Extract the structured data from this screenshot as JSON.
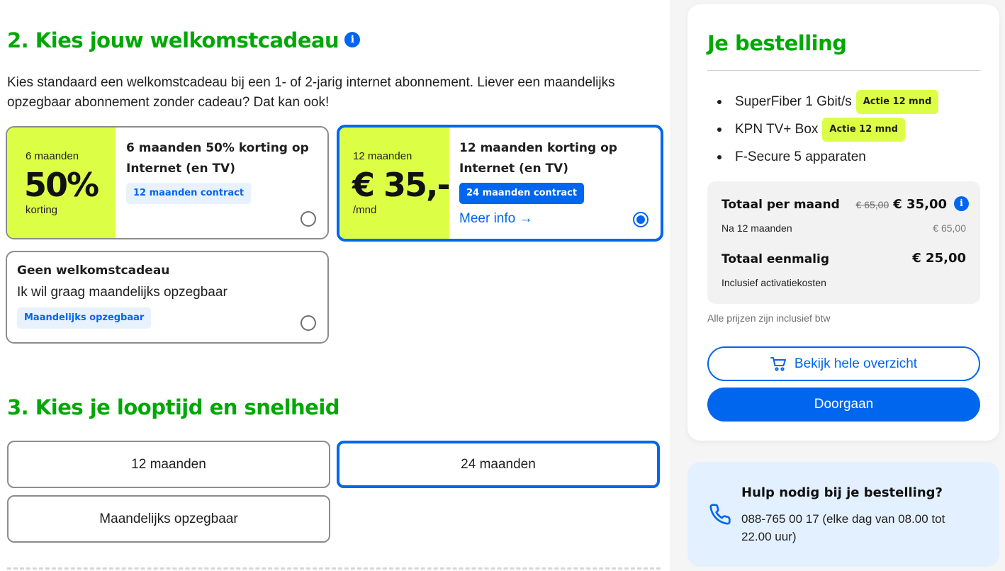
{
  "section2": {
    "title": "2. Kies jouw welkomstcadeau",
    "intro": "Kies standaard een welkomstcadeau bij een 1- of 2-jarig internet abonnement. Liever een maandelijks opzegbaar abonnement zonder cadeau? Dat kan ook!",
    "cards": [
      {
        "promo_top": "6 maanden",
        "promo_big": "50%",
        "promo_bottom": "korting",
        "title": "6 maanden 50% korting op Internet (en TV)",
        "badge": "12 maanden contract",
        "selected": false
      },
      {
        "promo_top": "12 maanden",
        "promo_big": "€ 35,-",
        "promo_bottom": "/mnd",
        "title": "12 maanden korting op Internet (en TV)",
        "badge": "24 maanden contract",
        "link": "Meer info →",
        "selected": true
      }
    ],
    "no_gift": {
      "title": "Geen welkomstcadeau",
      "subtitle": "Ik wil graag maandelijks opzegbaar",
      "badge": "Maandelijks opzegbaar",
      "selected": false
    }
  },
  "section3": {
    "title": "3. Kies je looptijd en snelheid",
    "options": [
      {
        "label": "12 maanden",
        "selected": false
      },
      {
        "label": "24 maanden",
        "selected": true
      },
      {
        "label": "Maandelijks opzegbaar",
        "selected": false
      }
    ]
  },
  "order": {
    "title": "Je bestelling",
    "items": [
      {
        "label": "SuperFiber 1 Gbit/s",
        "tag": "Actie 12 mnd"
      },
      {
        "label": "KPN TV+ Box",
        "tag": "Actie 12 mnd"
      },
      {
        "label": "F-Secure 5 apparaten",
        "tag": ""
      }
    ],
    "monthly_label": "Totaal per maand",
    "monthly_old": "€ 65,00",
    "monthly_new": "€ 35,00",
    "after_label": "Na 12 maanden",
    "after_value": "€ 65,00",
    "once_label": "Totaal eenmalig",
    "once_value": "€ 25,00",
    "once_note": "Inclusief activatiekosten",
    "vat_note": "Alle prijzen zijn inclusief btw",
    "overview_button": "Bekijk hele overzicht",
    "continue_button": "Doorgaan"
  },
  "help": {
    "title": "Hulp nodig bij je bestelling?",
    "text": "088-765 00 17 (elke dag van 08.00 tot 22.00 uur)"
  },
  "colors": {
    "brand_green": "#00a805",
    "accent_blue": "#0066ee",
    "promo_lime": "#dcff46"
  }
}
